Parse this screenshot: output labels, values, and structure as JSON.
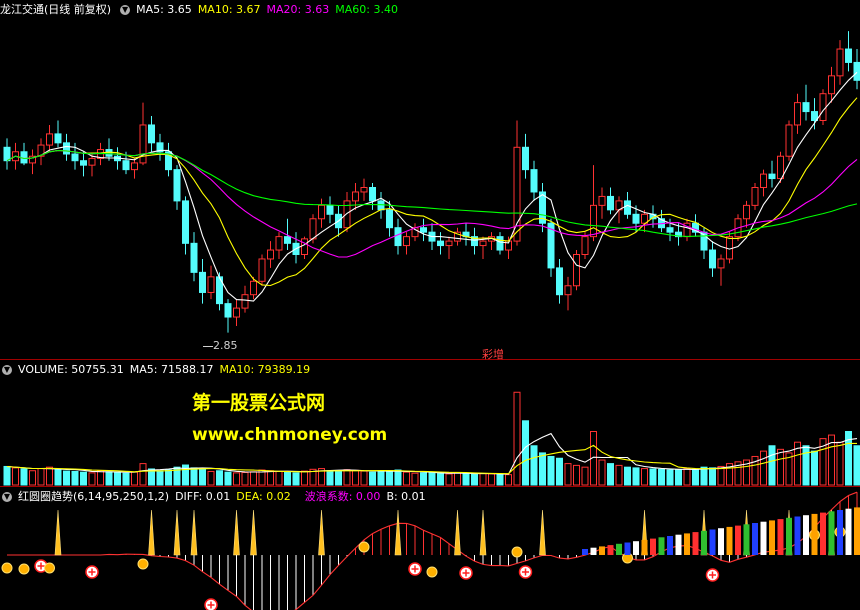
{
  "price_panel": {
    "stock_name": "龙江交通",
    "period": "(日线 前复权)",
    "ma5": "MA5: 3.65",
    "ma10": "MA10: 3.67",
    "ma20": "MA20: 3.63",
    "ma60": "MA60: 3.40",
    "low_label": "2.85",
    "event_label": "彩增"
  },
  "volume_panel": {
    "volume": "VOLUME: 50755.31",
    "ma5": "MA5: 71588.17",
    "ma10": "MA10: 79389.19"
  },
  "indicator_panel": {
    "name": "红圆圈趋势",
    "params": "(6,14,95,250,1,2)",
    "diff": "DIFF: 0.01",
    "dea": "DEA: 0.02",
    "wave": "波浪系数: 0.00",
    "b": "B: 0.01"
  },
  "watermark": {
    "line1": "第一股票公式网",
    "line2": "www.chnmoney.com"
  },
  "colors": {
    "up": "#ff3232",
    "down": "#54fcfc",
    "ma5": "#ffffff",
    "ma10": "#ffff00",
    "ma20": "#ff00ff",
    "ma60": "#00ff00",
    "separator": "#a00000"
  },
  "chart_data": [
    {
      "type": "candlestick",
      "title": "龙江交通",
      "annotations": [
        "2.85",
        "彩增"
      ],
      "series": [
        {
          "name": "MA5",
          "last": 3.65
        },
        {
          "name": "MA10",
          "last": 3.67
        },
        {
          "name": "MA20",
          "last": 3.63
        },
        {
          "name": "MA60",
          "last": 3.4
        }
      ],
      "ohlc": [
        [
          3.68,
          3.72,
          3.58,
          3.62
        ],
        [
          3.62,
          3.7,
          3.58,
          3.66
        ],
        [
          3.66,
          3.7,
          3.6,
          3.61
        ],
        [
          3.61,
          3.67,
          3.56,
          3.64
        ],
        [
          3.64,
          3.72,
          3.6,
          3.69
        ],
        [
          3.69,
          3.78,
          3.66,
          3.74
        ],
        [
          3.74,
          3.8,
          3.68,
          3.7
        ],
        [
          3.7,
          3.74,
          3.62,
          3.65
        ],
        [
          3.65,
          3.7,
          3.58,
          3.62
        ],
        [
          3.62,
          3.66,
          3.55,
          3.6
        ],
        [
          3.6,
          3.65,
          3.55,
          3.63
        ],
        [
          3.63,
          3.7,
          3.6,
          3.67
        ],
        [
          3.67,
          3.72,
          3.62,
          3.64
        ],
        [
          3.64,
          3.68,
          3.58,
          3.62
        ],
        [
          3.62,
          3.66,
          3.56,
          3.58
        ],
        [
          3.58,
          3.63,
          3.54,
          3.61
        ],
        [
          3.61,
          3.88,
          3.6,
          3.78
        ],
        [
          3.78,
          3.82,
          3.66,
          3.7
        ],
        [
          3.7,
          3.74,
          3.62,
          3.66
        ],
        [
          3.66,
          3.7,
          3.55,
          3.58
        ],
        [
          3.58,
          3.6,
          3.4,
          3.44
        ],
        [
          3.44,
          3.46,
          3.2,
          3.25
        ],
        [
          3.25,
          3.3,
          3.08,
          3.12
        ],
        [
          3.12,
          3.18,
          2.98,
          3.03
        ],
        [
          3.03,
          3.15,
          3.0,
          3.1
        ],
        [
          3.1,
          3.12,
          2.95,
          2.98
        ],
        [
          2.98,
          3.0,
          2.85,
          2.92
        ],
        [
          2.92,
          3.0,
          2.88,
          2.96
        ],
        [
          2.96,
          3.06,
          2.94,
          3.02
        ],
        [
          3.02,
          3.1,
          3.0,
          3.08
        ],
        [
          3.08,
          3.2,
          3.06,
          3.18
        ],
        [
          3.18,
          3.26,
          3.14,
          3.22
        ],
        [
          3.22,
          3.3,
          3.18,
          3.28
        ],
        [
          3.28,
          3.36,
          3.22,
          3.25
        ],
        [
          3.25,
          3.3,
          3.16,
          3.2
        ],
        [
          3.2,
          3.28,
          3.18,
          3.27
        ],
        [
          3.27,
          3.38,
          3.25,
          3.36
        ],
        [
          3.36,
          3.45,
          3.32,
          3.42
        ],
        [
          3.42,
          3.46,
          3.34,
          3.38
        ],
        [
          3.38,
          3.42,
          3.28,
          3.32
        ],
        [
          3.32,
          3.48,
          3.3,
          3.44
        ],
        [
          3.44,
          3.52,
          3.4,
          3.48
        ],
        [
          3.48,
          3.54,
          3.44,
          3.5
        ],
        [
          3.5,
          3.52,
          3.4,
          3.44
        ],
        [
          3.44,
          3.48,
          3.36,
          3.4
        ],
        [
          3.4,
          3.44,
          3.28,
          3.32
        ],
        [
          3.32,
          3.36,
          3.2,
          3.24
        ],
        [
          3.24,
          3.3,
          3.2,
          3.28
        ],
        [
          3.28,
          3.34,
          3.26,
          3.32
        ],
        [
          3.32,
          3.36,
          3.26,
          3.3
        ],
        [
          3.3,
          3.34,
          3.22,
          3.26
        ],
        [
          3.26,
          3.3,
          3.2,
          3.24
        ],
        [
          3.24,
          3.28,
          3.18,
          3.26
        ],
        [
          3.26,
          3.32,
          3.24,
          3.3
        ],
        [
          3.3,
          3.34,
          3.24,
          3.28
        ],
        [
          3.28,
          3.32,
          3.2,
          3.24
        ],
        [
          3.24,
          3.28,
          3.18,
          3.26
        ],
        [
          3.26,
          3.3,
          3.22,
          3.28
        ],
        [
          3.28,
          3.3,
          3.2,
          3.22
        ],
        [
          3.22,
          3.28,
          3.18,
          3.26
        ],
        [
          3.26,
          3.8,
          3.24,
          3.68
        ],
        [
          3.68,
          3.74,
          3.54,
          3.58
        ],
        [
          3.58,
          3.62,
          3.44,
          3.48
        ],
        [
          3.48,
          3.52,
          3.3,
          3.34
        ],
        [
          3.34,
          3.36,
          3.1,
          3.14
        ],
        [
          3.14,
          3.18,
          2.98,
          3.02
        ],
        [
          3.02,
          3.1,
          2.95,
          3.06
        ],
        [
          3.06,
          3.22,
          3.04,
          3.2
        ],
        [
          3.2,
          3.3,
          3.18,
          3.28
        ],
        [
          3.28,
          3.6,
          3.26,
          3.42
        ],
        [
          3.42,
          3.5,
          3.36,
          3.46
        ],
        [
          3.46,
          3.5,
          3.38,
          3.4
        ],
        [
          3.4,
          3.46,
          3.34,
          3.44
        ],
        [
          3.44,
          3.48,
          3.36,
          3.38
        ],
        [
          3.38,
          3.42,
          3.3,
          3.34
        ],
        [
          3.34,
          3.4,
          3.3,
          3.38
        ],
        [
          3.38,
          3.42,
          3.32,
          3.36
        ],
        [
          3.36,
          3.4,
          3.3,
          3.32
        ],
        [
          3.32,
          3.36,
          3.26,
          3.3
        ],
        [
          3.3,
          3.34,
          3.24,
          3.28
        ],
        [
          3.28,
          3.36,
          3.26,
          3.34
        ],
        [
          3.34,
          3.38,
          3.28,
          3.3
        ],
        [
          3.3,
          3.32,
          3.18,
          3.22
        ],
        [
          3.22,
          3.26,
          3.1,
          3.14
        ],
        [
          3.14,
          3.2,
          3.06,
          3.18
        ],
        [
          3.18,
          3.3,
          3.16,
          3.28
        ],
        [
          3.28,
          3.38,
          3.26,
          3.36
        ],
        [
          3.36,
          3.44,
          3.32,
          3.42
        ],
        [
          3.42,
          3.52,
          3.4,
          3.5
        ],
        [
          3.5,
          3.58,
          3.46,
          3.56
        ],
        [
          3.56,
          3.62,
          3.5,
          3.54
        ],
        [
          3.54,
          3.66,
          3.52,
          3.64
        ],
        [
          3.64,
          3.8,
          3.62,
          3.78
        ],
        [
          3.78,
          3.92,
          3.74,
          3.88
        ],
        [
          3.88,
          3.96,
          3.8,
          3.84
        ],
        [
          3.84,
          3.9,
          3.76,
          3.8
        ],
        [
          3.8,
          3.94,
          3.78,
          3.92
        ],
        [
          3.92,
          4.04,
          3.88,
          4.0
        ],
        [
          4.0,
          4.16,
          3.96,
          4.12
        ],
        [
          4.12,
          4.2,
          4.02,
          4.06
        ],
        [
          4.06,
          4.12,
          3.94,
          3.98
        ]
      ]
    },
    {
      "type": "bar",
      "title": "VOLUME",
      "series": [
        {
          "name": "VOLUME",
          "last": 50755.31
        },
        {
          "name": "MA5",
          "last": 71588.17
        },
        {
          "name": "MA10",
          "last": 79389.19
        }
      ],
      "values": [
        52000,
        48000,
        45000,
        40000,
        46000,
        50000,
        43000,
        39000,
        38000,
        36000,
        34000,
        40000,
        37000,
        35000,
        33000,
        36000,
        60000,
        45000,
        40000,
        42000,
        50000,
        56000,
        48000,
        44000,
        38000,
        40000,
        36000,
        34000,
        35000,
        37000,
        42000,
        40000,
        38000,
        36000,
        34000,
        39000,
        44000,
        46000,
        40000,
        38000,
        43000,
        41000,
        39000,
        36000,
        37000,
        40000,
        42000,
        36000,
        33000,
        34000,
        35000,
        32000,
        31000,
        34000,
        33000,
        30000,
        32000,
        31000,
        30000,
        29000,
        260000,
        180000,
        110000,
        90000,
        80000,
        75000,
        60000,
        55000,
        50000,
        150000,
        70000,
        60000,
        55000,
        50000,
        48000,
        46000,
        45000,
        44000,
        42000,
        43000,
        46000,
        44000,
        50000,
        48000,
        52000,
        60000,
        65000,
        70000,
        80000,
        95000,
        110000,
        100000,
        90000,
        120000,
        110000,
        95000,
        130000,
        140000,
        120000,
        150000,
        110000
      ]
    },
    {
      "type": "bar",
      "title": "红圆圈趋势",
      "series": [
        {
          "name": "DIFF",
          "last": 0.01
        },
        {
          "name": "DEA",
          "last": 0.02
        },
        {
          "name": "波浪系数",
          "last": 0.0
        },
        {
          "name": "B",
          "last": 0.01
        }
      ]
    }
  ]
}
